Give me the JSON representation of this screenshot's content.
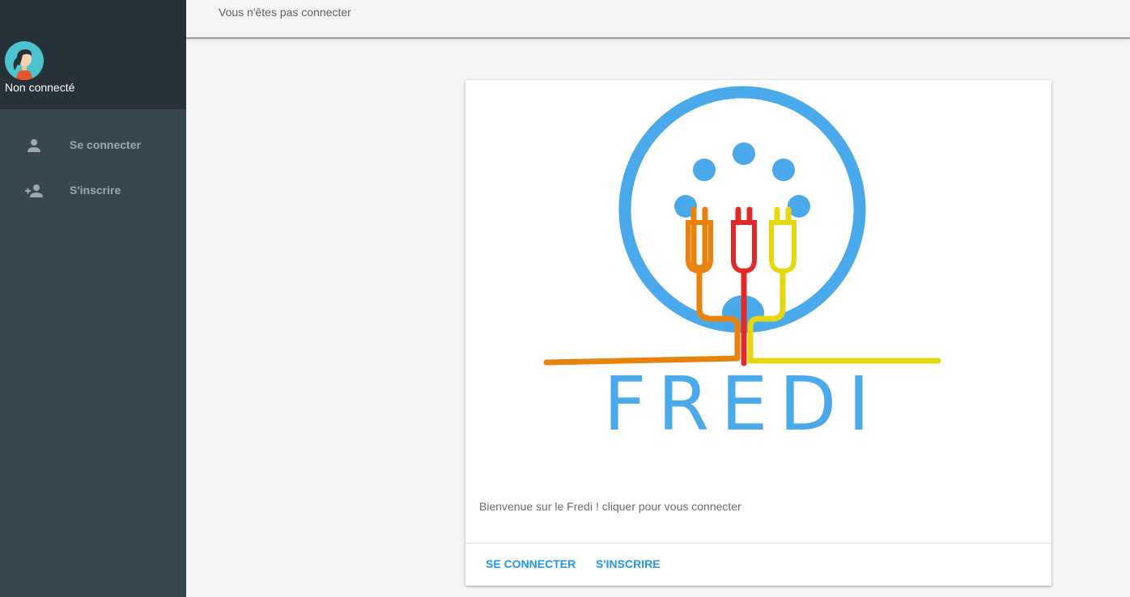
{
  "sidebar": {
    "user_status": "Non connecté",
    "avatar_icon": "user-avatar-icon",
    "items": [
      {
        "label": "Se connecter",
        "icon": "person-icon"
      },
      {
        "label": "S'inscrire",
        "icon": "person-add-icon"
      }
    ]
  },
  "topbar": {
    "status_text": "Vous n'êtes pas connecter"
  },
  "card": {
    "logo_text": "FREDI",
    "welcome_text": "Bienvenue sur le Fredi ! cliquer pour vous connecter",
    "actions": {
      "login_label": "SE CONNECTER",
      "register_label": "S'INSCRIRE"
    }
  },
  "colors": {
    "sidebar_bg": "#37474f",
    "sidebar_header_bg": "#263238",
    "accent": "#2196f3",
    "logo_blue": "#4aa9ea",
    "cable_orange": "#e8820c",
    "cable_red": "#e02a2a",
    "cable_yellow": "#e6d80e"
  }
}
